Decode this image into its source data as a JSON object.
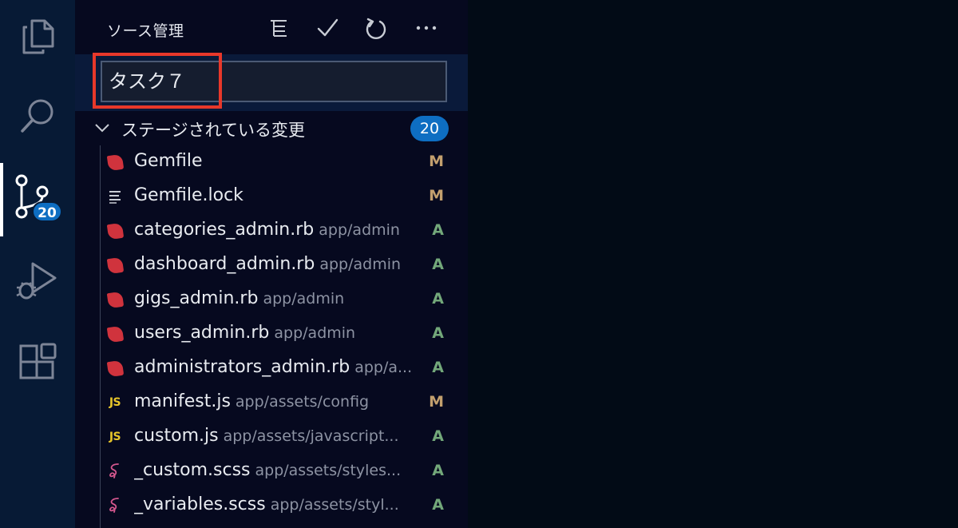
{
  "activity_bar": {
    "items": [
      {
        "icon": "explorer-files-icon"
      },
      {
        "icon": "search-icon"
      },
      {
        "icon": "source-control-icon",
        "badge": "20",
        "active": true
      },
      {
        "icon": "run-debug-icon"
      },
      {
        "icon": "extensions-icon"
      }
    ]
  },
  "sidebar": {
    "title": "ソース管理",
    "toolbar": [
      {
        "icon": "view-as-tree-icon"
      },
      {
        "icon": "commit-checkmark-icon"
      },
      {
        "icon": "refresh-icon"
      },
      {
        "icon": "more-actions-icon"
      }
    ]
  },
  "commit": {
    "message": "タスク７",
    "highlight_color": "#e8382a"
  },
  "section": {
    "label": "ステージされている変更",
    "count": "20"
  },
  "files": [
    {
      "icon": "ruby-file-icon",
      "name": "Gemfile",
      "path": "",
      "status": "M"
    },
    {
      "icon": "lines-file-icon",
      "name": "Gemfile.lock",
      "path": "",
      "status": "M"
    },
    {
      "icon": "ruby-file-icon",
      "name": "categories_admin.rb",
      "path": "app/admin",
      "status": "A"
    },
    {
      "icon": "ruby-file-icon",
      "name": "dashboard_admin.rb",
      "path": "app/admin",
      "status": "A"
    },
    {
      "icon": "ruby-file-icon",
      "name": "gigs_admin.rb",
      "path": "app/admin",
      "status": "A"
    },
    {
      "icon": "ruby-file-icon",
      "name": "users_admin.rb",
      "path": "app/admin",
      "status": "A"
    },
    {
      "icon": "ruby-file-icon",
      "name": "administrators_admin.rb",
      "path": "app/a...",
      "status": "A"
    },
    {
      "icon": "js-file-icon",
      "name": "manifest.js",
      "path": "app/assets/config",
      "status": "M"
    },
    {
      "icon": "js-file-icon",
      "name": "custom.js",
      "path": "app/assets/javascript...",
      "status": "A"
    },
    {
      "icon": "sass-file-icon",
      "name": "_custom.scss",
      "path": "app/assets/styles...",
      "status": "A"
    },
    {
      "icon": "sass-file-icon",
      "name": "_variables.scss",
      "path": "app/assets/styl...",
      "status": "A"
    }
  ],
  "colors": {
    "status_modified": "#c3a06e",
    "status_added": "#73a87a",
    "badge": "#0e6ec2"
  }
}
